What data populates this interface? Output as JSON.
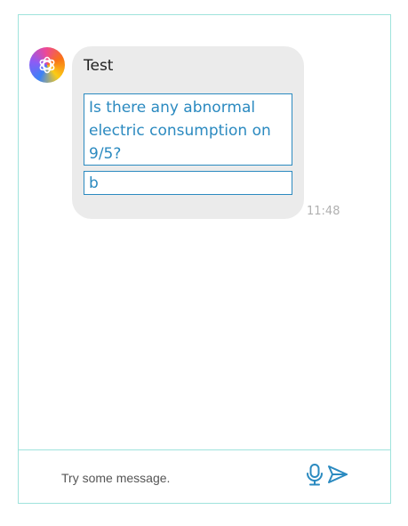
{
  "bot": {
    "avatar_icon": "openai-logo-icon"
  },
  "message": {
    "title": "Test",
    "options": [
      {
        "label": "Is there any abnormal electric consumption on 9/5?"
      },
      {
        "label": "b"
      }
    ],
    "time": "11:48"
  },
  "composer": {
    "placeholder": "Try some message.",
    "mic_icon": "microphone-icon",
    "send_icon": "send-icon"
  },
  "colors": {
    "border": "#9fe3dc",
    "accent": "#2b8ac0",
    "bubble": "#ebebeb"
  }
}
